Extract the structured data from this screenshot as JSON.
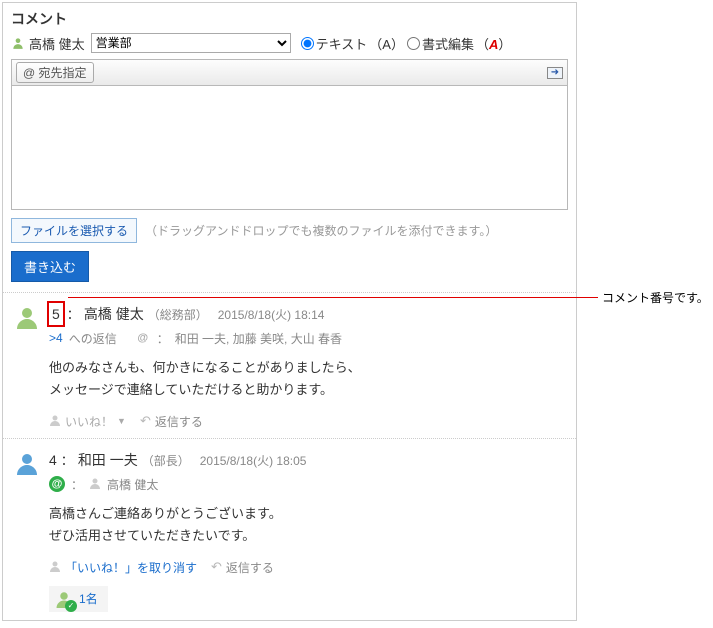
{
  "header": {
    "title": "コメント"
  },
  "composer": {
    "username": "高橋 健太",
    "dept_options": [
      "営業部"
    ],
    "dept_selected": "営業部",
    "format_text_label": "テキスト",
    "format_rich_label": "書式編集",
    "mention_button": "@ 宛先指定",
    "file_button": "ファイルを選択する",
    "attach_hint": "（ドラッグアンドドロップでも複数のファイルを添付できます。）",
    "submit": "書き込む"
  },
  "comments": [
    {
      "num": "5",
      "name": "高橋 健太",
      "dept": "（総務部）",
      "time": "2015/8/18(火) 18:14",
      "reply_to_link": ">4",
      "reply_to_label": "への返信",
      "mentions": "和田 一夫, 加藤 美咲, 大山 春香",
      "body_l1": "他のみなさんも、何かきになることがありましたら、",
      "body_l2": "メッセージで連絡していただけると助かります。",
      "like_label": "いいね！",
      "reply_label": "返信する"
    },
    {
      "num": "4",
      "name": "和田 一夫",
      "dept": "（部長）",
      "time": "2015/8/18(火) 18:05",
      "mention_to": "高橋 健太",
      "body_l1": "高橋さんご連絡ありがとうございます。",
      "body_l2": "ぜひ活用させていただきたいです。",
      "unlike_label": "「いいね！」を取り消す",
      "reply_label": "返信する",
      "likes_count": "1名"
    }
  ],
  "callout": {
    "label": "コメント番号です。"
  }
}
